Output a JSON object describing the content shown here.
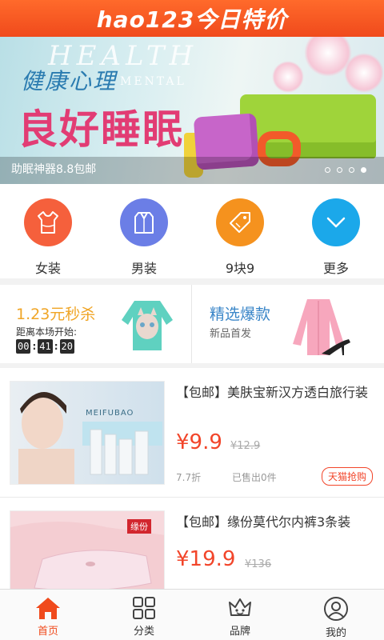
{
  "header": {
    "logo": "hao123今日特价"
  },
  "banner": {
    "bg_word_1": "HEALTH",
    "bg_word_2": "MENTAL",
    "subtitle": "健康心理",
    "headline": "良好睡眠",
    "caption": "助眠神器8.8包邮",
    "slide_count": 4,
    "active_slide": 4
  },
  "categories": [
    {
      "label": "女装",
      "icon": "dress-icon",
      "color": "#f5603c"
    },
    {
      "label": "男装",
      "icon": "shirt-icon",
      "color": "#6b7ee6"
    },
    {
      "label": "9块9",
      "icon": "price-tag-icon",
      "color": "#f5921e"
    },
    {
      "label": "更多",
      "icon": "chevron-down-icon",
      "color": "#1ba8ea"
    }
  ],
  "promo": {
    "left_title": "1.23元秒杀",
    "left_subtitle": "距离本场开始:",
    "timer": [
      "00",
      "41",
      "20"
    ],
    "right_title": "精选爆款",
    "right_subtitle": "新品首发"
  },
  "products": [
    {
      "title": "【包邮】美肤宝新汉方透白旅行装",
      "price": "¥9.9",
      "original_price": "¥12.9",
      "discount": "7.7折",
      "sold": "已售出0件",
      "badge": "天猫抢购",
      "image_brand": "MEIFUBAO"
    },
    {
      "title": "【包邮】缘份莫代尔内裤3条装",
      "price": "¥19.9",
      "original_price": "¥136",
      "image_brand": "缘份"
    }
  ],
  "tabbar": [
    {
      "label": "首页",
      "icon": "home-icon",
      "active": true
    },
    {
      "label": "分类",
      "icon": "grid-icon",
      "active": false
    },
    {
      "label": "品牌",
      "icon": "brand-crown-icon",
      "active": false
    },
    {
      "label": "我的",
      "icon": "user-icon",
      "active": false
    }
  ],
  "colors": {
    "accent": "#f04a1c",
    "price": "#f2452a",
    "flash_sale": "#f0a526",
    "hot_pick": "#3a86c8"
  }
}
